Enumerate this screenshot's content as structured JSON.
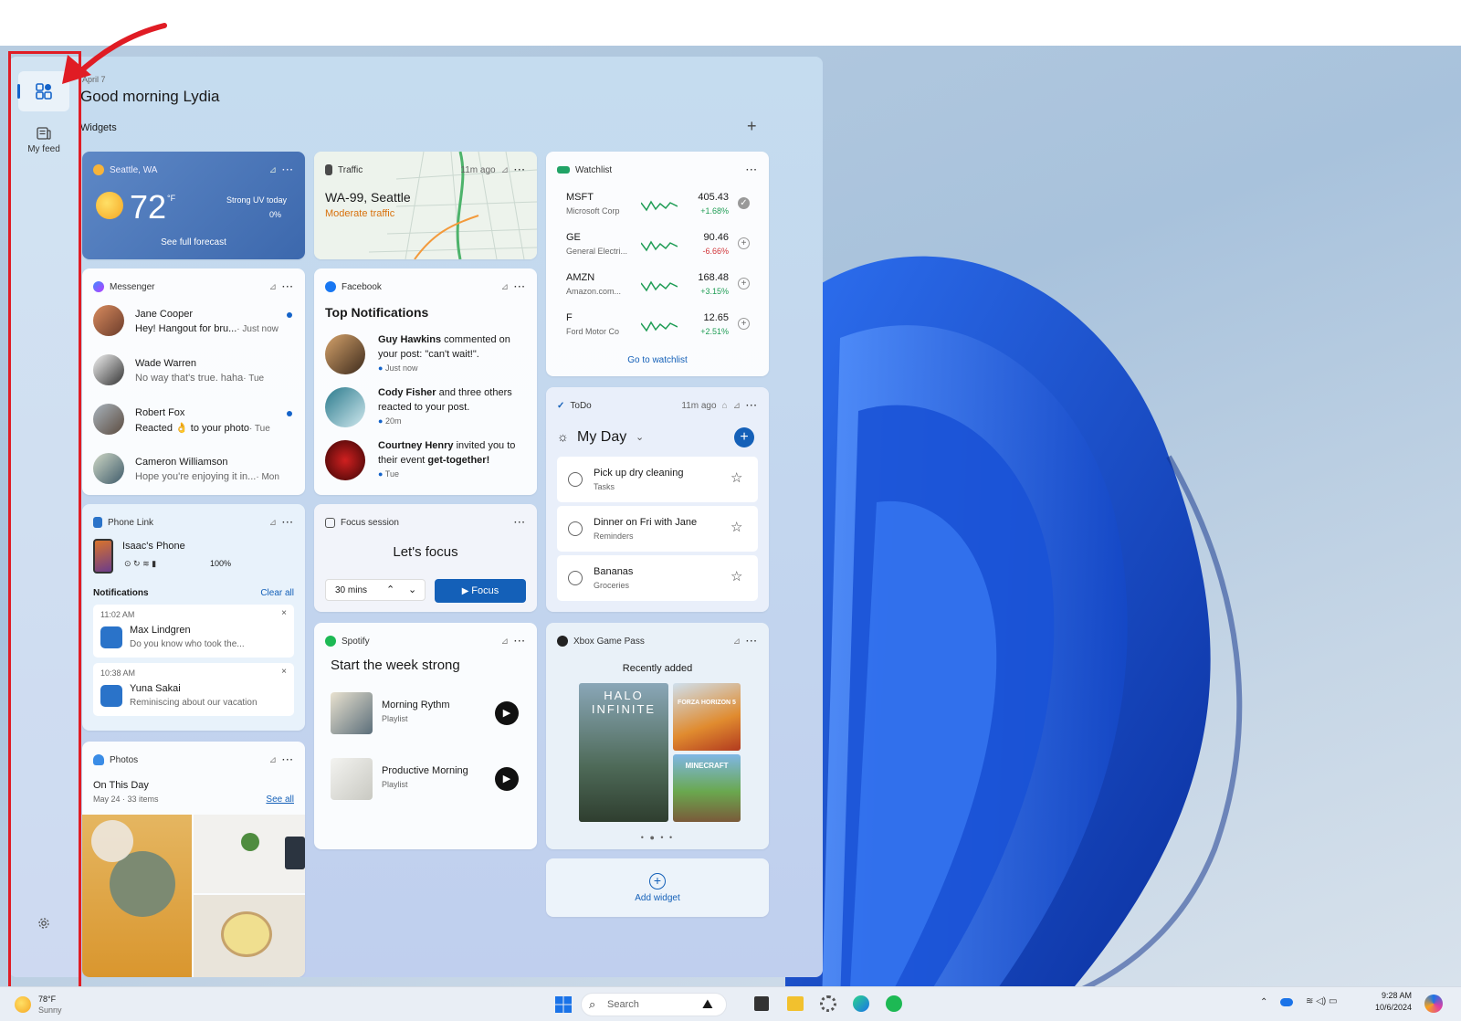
{
  "greeting": {
    "small": "April 7",
    "title": "Good morning Lydia"
  },
  "widgets_label": "Widgets",
  "add_icon": "plus-icon",
  "rail": {
    "widgets_icon": "widgets-icon",
    "feed_label": "My feed",
    "settings_icon": "gear-icon"
  },
  "weather": {
    "location": "Seattle, WA",
    "temp": "72",
    "unit": "°F",
    "uv": "Strong UV today",
    "precip": "0%",
    "forecast_link": "See full forecast"
  },
  "traffic": {
    "label": "Traffic",
    "time": "11m ago",
    "route": "WA-99, Seattle",
    "status": "Moderate traffic"
  },
  "watchlist": {
    "label": "Watchlist",
    "stocks": [
      {
        "symbol": "MSFT",
        "name": "Microsoft Corp",
        "price": "405.43",
        "change": "+1.68%",
        "dir": "up"
      },
      {
        "symbol": "GE",
        "name": "General Electri...",
        "price": "90.46",
        "change": "-6.66%",
        "dir": "down"
      },
      {
        "symbol": "AMZN",
        "name": "Amazon.com...",
        "price": "168.48",
        "change": "+3.15%",
        "dir": "up"
      },
      {
        "symbol": "F",
        "name": "Ford Motor Co",
        "price": "12.65",
        "change": "+2.51%",
        "dir": "up"
      }
    ],
    "link": "Go to watchlist"
  },
  "messenger": {
    "label": "Messenger",
    "items": [
      {
        "name": "Jane Cooper",
        "text": "Hey! Hangout for bru...",
        "time": "· Just now",
        "unread": true
      },
      {
        "name": "Wade Warren",
        "text": "No way that's true. haha",
        "time": "· Tue",
        "unread": false
      },
      {
        "name": "Robert Fox",
        "text": "Reacted 👌 to your photo",
        "time": "· Tue",
        "unread": true
      },
      {
        "name": "Cameron Williamson",
        "text": "Hope you're enjoying it in...",
        "time": "· Mon",
        "unread": false
      }
    ]
  },
  "facebook": {
    "label": "Facebook",
    "title": "Top Notifications",
    "items": [
      {
        "actor": "Guy Hawkins",
        "text": " commented on your post: \"can't wait!\".",
        "time": "Just now"
      },
      {
        "actor": "Cody Fisher",
        "text": " and three others reacted to your post.",
        "time": "20m"
      },
      {
        "actor": "Courtney Henry",
        "text": " invited you to their event ",
        "event": "get-together!",
        "time": "Tue"
      }
    ]
  },
  "todo": {
    "label": "ToDo",
    "time": "11m ago",
    "title": "My Day",
    "tasks": [
      {
        "title": "Pick up dry cleaning",
        "list": "Tasks"
      },
      {
        "title": "Dinner on Fri with Jane",
        "list": "Reminders"
      },
      {
        "title": "Bananas",
        "list": "Groceries"
      }
    ]
  },
  "phone": {
    "label": "Phone Link",
    "device": "Isaac's Phone",
    "battery": "100%",
    "notif_label": "Notifications",
    "clear": "Clear all",
    "notifs": [
      {
        "time": "11:02 AM",
        "name": "Max Lindgren",
        "text": "Do you know who took the..."
      },
      {
        "time": "10:38 AM",
        "name": "Yuna Sakai",
        "text": "Reminiscing about our vacation"
      }
    ]
  },
  "focus": {
    "label": "Focus session",
    "title": "Let's focus",
    "duration": "30 mins",
    "button": "Focus"
  },
  "spotify": {
    "label": "Spotify",
    "title": "Start the week strong",
    "items": [
      {
        "name": "Morning Rythm",
        "type": "Playlist"
      },
      {
        "name": "Productive Morning",
        "type": "Playlist"
      }
    ]
  },
  "xbox": {
    "label": "Xbox Game Pass",
    "sub": "Recently added",
    "games": [
      "HALO INFINITE",
      "FORZA HORIZON 5",
      "MINECRAFT"
    ]
  },
  "photos": {
    "label": "Photos",
    "title": "On This Day",
    "sub": "May 24 · 33 items",
    "link": "See all"
  },
  "add_widget": "Add widget",
  "taskbar": {
    "temp": "78°F",
    "cond": "Sunny",
    "search": "Search",
    "time": "9:28 AM",
    "date": "10/6/2024"
  }
}
